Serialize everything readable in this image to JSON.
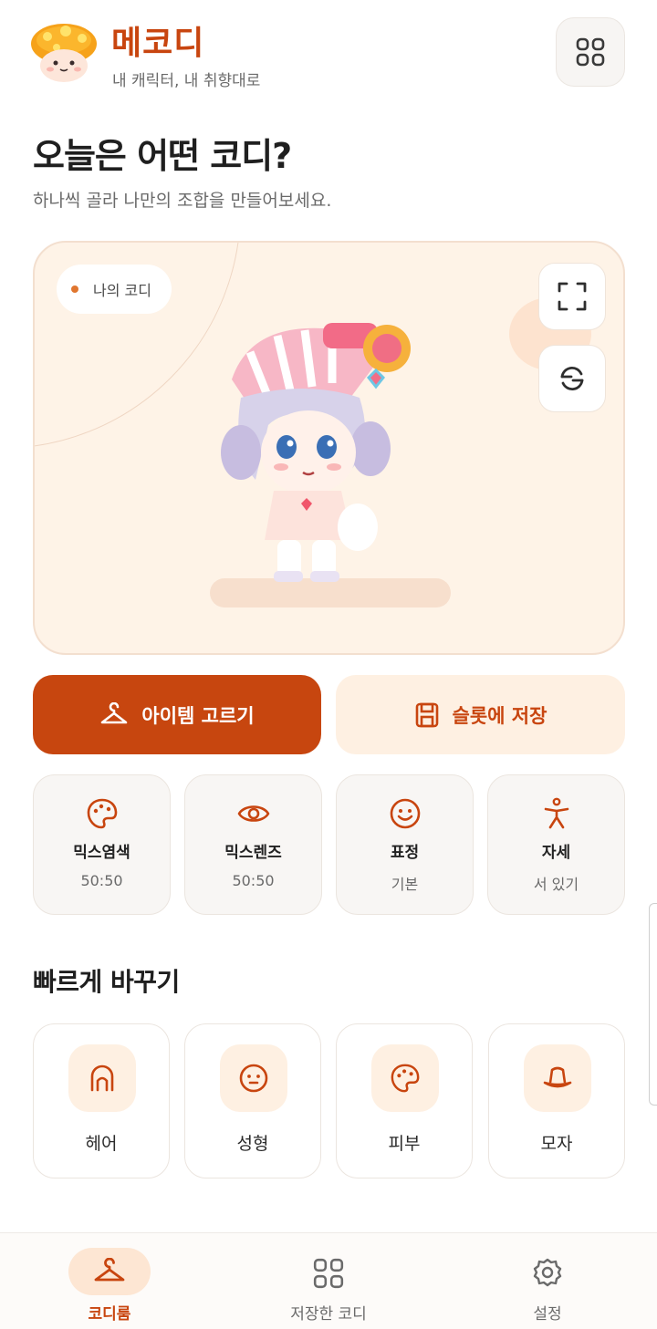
{
  "header": {
    "title": "메코디",
    "subtitle": "내 캐릭터, 내 취향대로",
    "menu_icon": "grid-icon"
  },
  "page": {
    "title": "오늘은 어떤 코디?",
    "subtitle": "하나씩 골라 나만의 조합을 만들어보세요."
  },
  "stage": {
    "badge": "나의 코디",
    "fullscreen_icon": "fullscreen-icon",
    "refresh_icon": "refresh-icon"
  },
  "actions": {
    "primary": "아이템 고르기",
    "secondary": "슬롯에 저장"
  },
  "options": [
    {
      "label": "믹스염색",
      "value": "50:50",
      "icon": "palette-icon"
    },
    {
      "label": "믹스렌즈",
      "value": "50:50",
      "icon": "eye-icon"
    },
    {
      "label": "표정",
      "value": "기본",
      "icon": "smile-icon"
    },
    {
      "label": "자세",
      "value": "서 있기",
      "icon": "person-icon"
    }
  ],
  "quick": {
    "title": "빠르게 바꾸기",
    "items": [
      {
        "label": "헤어",
        "icon": "hair-icon"
      },
      {
        "label": "성형",
        "icon": "face-icon"
      },
      {
        "label": "피부",
        "icon": "palette-icon"
      },
      {
        "label": "모자",
        "icon": "hat-icon"
      }
    ]
  },
  "nav": [
    {
      "label": "코디룸",
      "icon": "hanger-icon",
      "active": true
    },
    {
      "label": "저장한 코디",
      "icon": "grid-icon",
      "active": false
    },
    {
      "label": "설정",
      "icon": "gear-icon",
      "active": false
    }
  ],
  "colors": {
    "accent": "#c7460f",
    "accent_soft": "#fef0e2",
    "stage_bg": "#fef3e7"
  }
}
